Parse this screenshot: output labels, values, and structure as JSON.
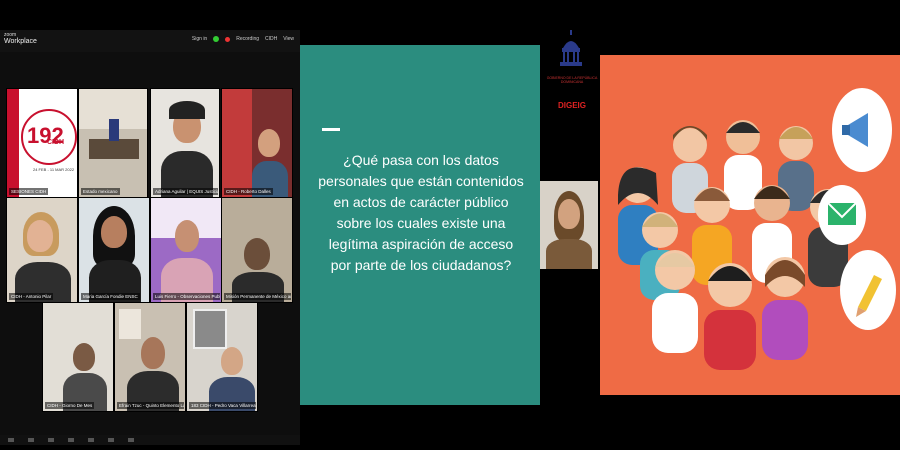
{
  "zoom": {
    "brand_line1": "zoom",
    "brand_line2": "Workplace",
    "signin": "Sign in",
    "recording": "Recording",
    "cidh": "CIDH",
    "view": "View",
    "tiles": [
      {
        "name": "SESIONES CIDH"
      },
      {
        "name": "Estado mexicano"
      },
      {
        "name": "Adriana Aguilar | EQUIS Justicia ENSC"
      },
      {
        "name": "CIDH - Roberto Dalles"
      },
      {
        "name": "CIDH - Antonio Pilar"
      },
      {
        "name": "Maria García Fondie ENSC"
      },
      {
        "name": "Luis Fierro - Observaciones Publicas ENSC"
      },
      {
        "name": "Misión Permanente de México ante la OEA/EDF"
      },
      {
        "name": "CIDH - Giorno De Mes"
      },
      {
        "name": "Efrain Tzuc - Quinto Elemento Lab ENSC"
      },
      {
        "name": "183 CIDH - Pedro Vaca Villarreal"
      }
    ],
    "poster": {
      "number": "192",
      "subtitle": "PERIODO DE SESIONES",
      "org": "CIDH",
      "dates": "24 FEB - 11 MAR 2022"
    }
  },
  "slide": {
    "question": "¿Qué pasa con los datos personales que están contenidos en actos de carácter público sobre los cuales existe una legítima aspiración de acceso por parte de los ciudadanos?",
    "bg_color": "#2b8d7f"
  },
  "logo": {
    "line1": "GOBIERNO DE LA REPÚBLICA DOMINICANA",
    "line2": "DIGEIG",
    "icon": "dome-icon"
  },
  "illustration": {
    "bg_color": "#ef6b45",
    "icons": [
      "megaphone-icon",
      "envelope-icon",
      "pencil-icon"
    ]
  }
}
